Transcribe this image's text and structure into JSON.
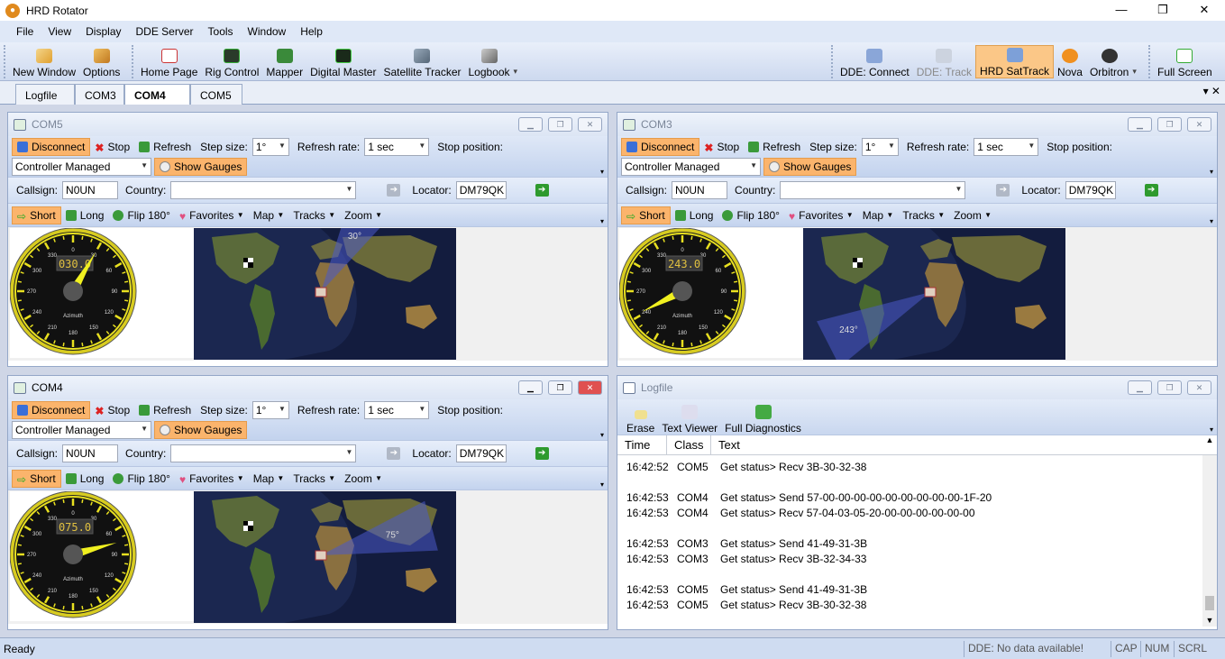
{
  "window": {
    "title": "HRD Rotator",
    "min": "—",
    "max": "❐",
    "close": "✕"
  },
  "menu": [
    "File",
    "View",
    "Display",
    "DDE Server",
    "Tools",
    "Window",
    "Help"
  ],
  "toolbar": {
    "group1": [
      {
        "label": "New Window",
        "icon": "new-window-icon"
      },
      {
        "label": "Options",
        "icon": "options-icon"
      }
    ],
    "group2": [
      {
        "label": "Home Page",
        "icon": "home-page-icon"
      },
      {
        "label": "Rig Control",
        "icon": "rig-control-icon"
      },
      {
        "label": "Mapper",
        "icon": "mapper-icon"
      },
      {
        "label": "Digital Master",
        "icon": "digital-master-icon"
      },
      {
        "label": "Satellite Tracker",
        "icon": "satellite-icon"
      },
      {
        "label": "Logbook",
        "icon": "logbook-icon"
      }
    ],
    "group3": [
      {
        "label": "DDE: Connect",
        "icon": "dde-connect-icon"
      },
      {
        "label": "DDE: Track",
        "icon": "dde-track-icon"
      },
      {
        "label": "HRD SatTrack",
        "icon": "sattrack-icon"
      },
      {
        "label": "Nova",
        "icon": "nova-icon"
      },
      {
        "label": "Orbitron",
        "icon": "orbitron-icon"
      }
    ],
    "group4": [
      {
        "label": "Full Screen",
        "icon": "full-screen-icon"
      }
    ]
  },
  "tabs": [
    "Logfile",
    "COM3",
    "COM4",
    "COM5"
  ],
  "tab_close": "✕",
  "tab_controls": "▾ ✕",
  "rotator_common": {
    "disconnect": "Disconnect",
    "stop": "Stop",
    "refresh": "Refresh",
    "step_label": "Step size:",
    "step_value": "1°",
    "rate_label": "Refresh rate:",
    "rate_value": "1 sec",
    "stop_pos_label": "Stop position:",
    "mode_value": "Controller Managed",
    "show_gauges": "Show Gauges",
    "callsign_label": "Callsign:",
    "callsign_value": "N0UN",
    "country_label": "Country:",
    "country_value": "",
    "locator_label": "Locator:",
    "locator_value": "DM79QK",
    "short": "Short",
    "long": "Long",
    "flip": "Flip 180°",
    "favorites": "Favorites",
    "map": "Map",
    "tracks": "Tracks",
    "zoom": "Zoom",
    "gauge_caption": "Azimuth"
  },
  "panels": [
    {
      "title": "COM5",
      "azimuth_text": "030.0",
      "azimuth": 30,
      "map_label": "30°",
      "active": false
    },
    {
      "title": "COM3",
      "azimuth_text": "243.0",
      "azimuth": 243,
      "map_label": "243°",
      "active": false
    },
    {
      "title": "COM4",
      "azimuth_text": "075.0",
      "azimuth": 75,
      "map_label": "75°",
      "active": true
    }
  ],
  "logfile": {
    "title": "Logfile",
    "tools": [
      {
        "label": "Erase",
        "icon": "eraser-icon"
      },
      {
        "label": "Text Viewer",
        "icon": "text-viewer-icon"
      },
      {
        "label": "Full Diagnostics",
        "icon": "diagnostics-icon"
      }
    ],
    "columns": [
      "Time",
      "Class",
      "Text"
    ],
    "rows": [
      {
        "time": "16:42:52",
        "cls": "COM5",
        "text": "Get status> Recv 3B-30-32-38"
      },
      {
        "time": "",
        "cls": "",
        "text": ""
      },
      {
        "time": "16:42:53",
        "cls": "COM4",
        "text": "Get status> Send 57-00-00-00-00-00-00-00-00-00-1F-20"
      },
      {
        "time": "16:42:53",
        "cls": "COM4",
        "text": "Get status> Recv 57-04-03-05-20-00-00-00-00-00-00"
      },
      {
        "time": "",
        "cls": "",
        "text": ""
      },
      {
        "time": "16:42:53",
        "cls": "COM3",
        "text": "Get status> Send 41-49-31-3B"
      },
      {
        "time": "16:42:53",
        "cls": "COM3",
        "text": "Get status> Recv 3B-32-34-33"
      },
      {
        "time": "",
        "cls": "",
        "text": ""
      },
      {
        "time": "16:42:53",
        "cls": "COM5",
        "text": "Get status> Send 41-49-31-3B"
      },
      {
        "time": "16:42:53",
        "cls": "COM5",
        "text": "Get status> Recv 3B-30-32-38"
      }
    ]
  },
  "status": {
    "left": "Ready",
    "dde": "DDE: No data available!",
    "cap": "CAP",
    "num": "NUM",
    "scrl": "SCRL"
  },
  "colors": {
    "accent_orange": "#fbb46c",
    "gauge_yellow": "#f0e020",
    "map_ocean": "#1c2a55"
  }
}
